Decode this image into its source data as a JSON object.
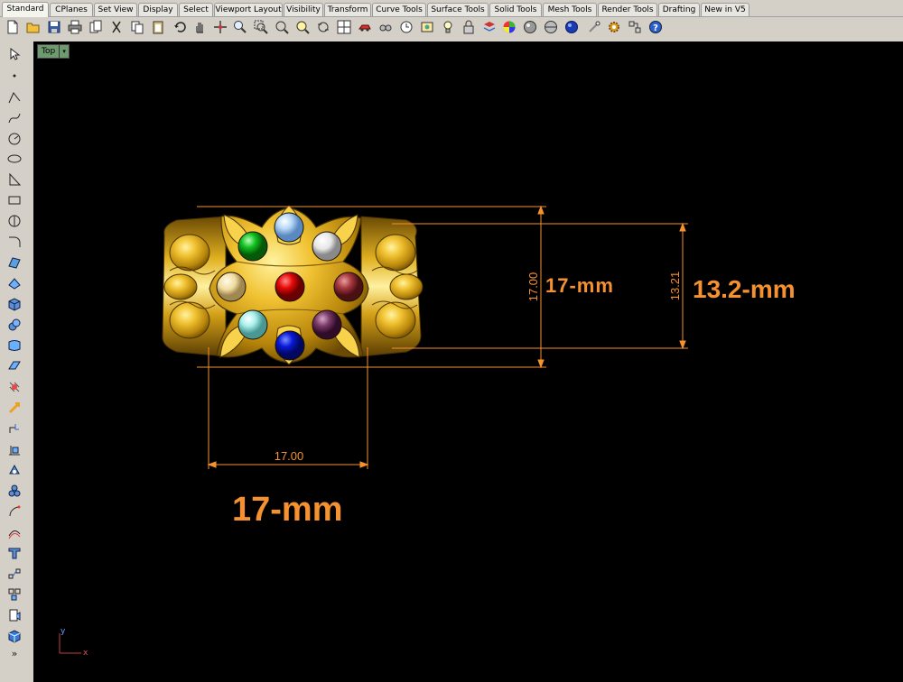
{
  "tabs": [
    "Standard",
    "CPlanes",
    "Set View",
    "Display",
    "Select",
    "Viewport Layout",
    "Visibility",
    "Transform",
    "Curve Tools",
    "Surface Tools",
    "Solid Tools",
    "Mesh Tools",
    "Render Tools",
    "Drafting",
    "New in V5"
  ],
  "viewport": {
    "name": "Top",
    "menu_arrow": "▾"
  },
  "dimensions": {
    "width_value": "17.00",
    "height_value": "17.00",
    "inner_height_value": "13.21",
    "inner_label": "17-mm",
    "right_label": "13.2-mm",
    "bottom_label": "17-mm"
  },
  "axis": {
    "x": "x",
    "y": "y"
  },
  "sidebar_more": "»",
  "colors": {
    "dimension": "#f6912f",
    "gold": "#d4a017",
    "viewport_bg": "#000000"
  },
  "gems": [
    "green",
    "light-blue",
    "white",
    "champagne",
    "red",
    "garnet",
    "aquamarine",
    "blue",
    "amethyst"
  ]
}
